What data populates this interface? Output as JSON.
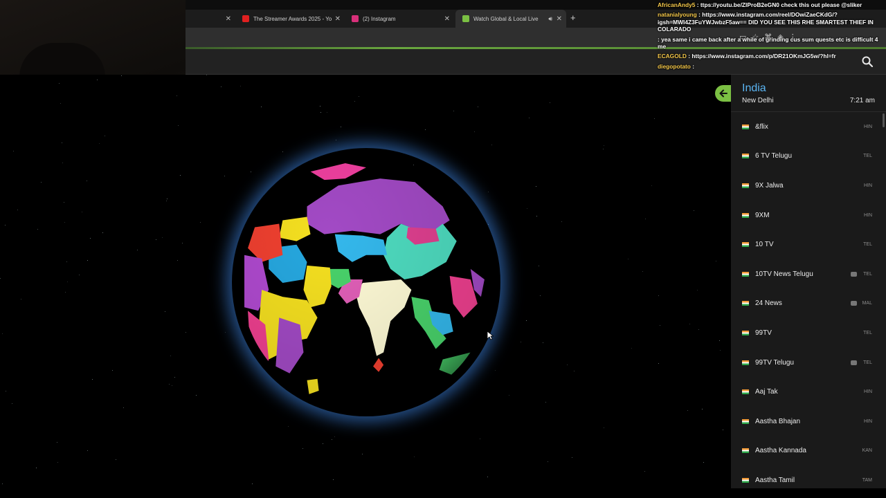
{
  "browser": {
    "tabs": [
      {
        "label": "The Streamer Awards 2025 - Yo",
        "icon_color": "#e02020",
        "active": false
      },
      {
        "label": "(2) Instagram",
        "icon_color": "#d8307a",
        "active": false
      },
      {
        "label": "Watch Global & Local Live",
        "icon_color": "#7bc043",
        "active": true
      }
    ],
    "new_tab_icon": "plus-icon"
  },
  "chat": [
    {
      "user": "AfricanAndy5",
      "text": ": ttps://youtu.be/ZIProB2eGN0 check this out please @sliker",
      "color": "yellow"
    },
    {
      "user": "natanialyoung",
      "text": ": https://www.instagram.com/reel/DOwiZaeCKdG/?igsh=MWI4Z3FuYWJwbzF5aw== DID YOU SEE THIS RHE SMARTEST THIEF IN COLARADO",
      "color": "yellow"
    },
    {
      "user": "",
      "text": ": yea same i came back after a while of grinding cus sum quests etc is difficult 4 me",
      "color": "red"
    },
    {
      "user": "ECAGOLD",
      "text": ": https://www.instagram.com/p/DR21OKmJG5w/?hl=fr",
      "color": "yellow"
    },
    {
      "user": "diegopotato",
      "text": ":",
      "color": "yellow"
    }
  ],
  "panel": {
    "country": "India",
    "city": "New Delhi",
    "time": "7:21 am",
    "channels": [
      {
        "name": "&flix",
        "lang": "HIN",
        "yt": false
      },
      {
        "name": "6 TV Telugu",
        "lang": "TEL",
        "yt": false
      },
      {
        "name": "9X Jalwa",
        "lang": "HIN",
        "yt": false
      },
      {
        "name": "9XM",
        "lang": "HIN",
        "yt": false
      },
      {
        "name": "10 TV",
        "lang": "TEL",
        "yt": false
      },
      {
        "name": "10TV News Telugu",
        "lang": "TEL",
        "yt": true
      },
      {
        "name": "24 News",
        "lang": "MAL",
        "yt": true
      },
      {
        "name": "99TV",
        "lang": "TEL",
        "yt": false
      },
      {
        "name": "99TV Telugu",
        "lang": "TEL",
        "yt": true
      },
      {
        "name": "Aaj Tak",
        "lang": "HIN",
        "yt": false
      },
      {
        "name": "Aastha Bhajan",
        "lang": "HIN",
        "yt": false
      },
      {
        "name": "Aastha Kannada",
        "lang": "KAN",
        "yt": false
      },
      {
        "name": "Aastha Tamil",
        "lang": "TAM",
        "yt": false
      }
    ]
  },
  "colors": {
    "accent_green": "#7bc043",
    "country_blue": "#5ab4f2",
    "ocean": "#000000",
    "india": "#fffbd6"
  }
}
